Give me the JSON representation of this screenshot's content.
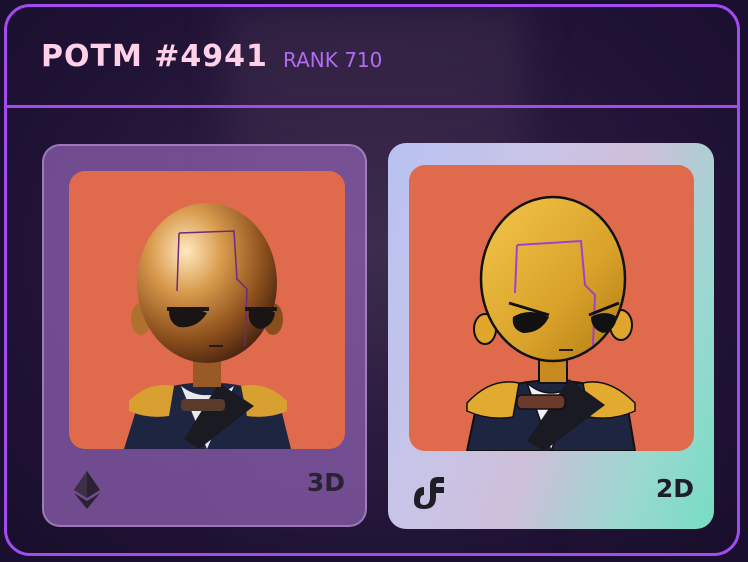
{
  "header": {
    "title": "POTM #4941",
    "rank": "RANK 710"
  },
  "cards": [
    {
      "label": "3D",
      "chain_icon": "ethereum-icon",
      "art_background": "#e06a4c"
    },
    {
      "label": "2D",
      "chain_icon": "flow-icon",
      "art_background": "#e06a4c"
    }
  ],
  "colors": {
    "accent_border": "#a04cf0",
    "title": "#ffd0e8",
    "rank": "#b06cf2"
  }
}
